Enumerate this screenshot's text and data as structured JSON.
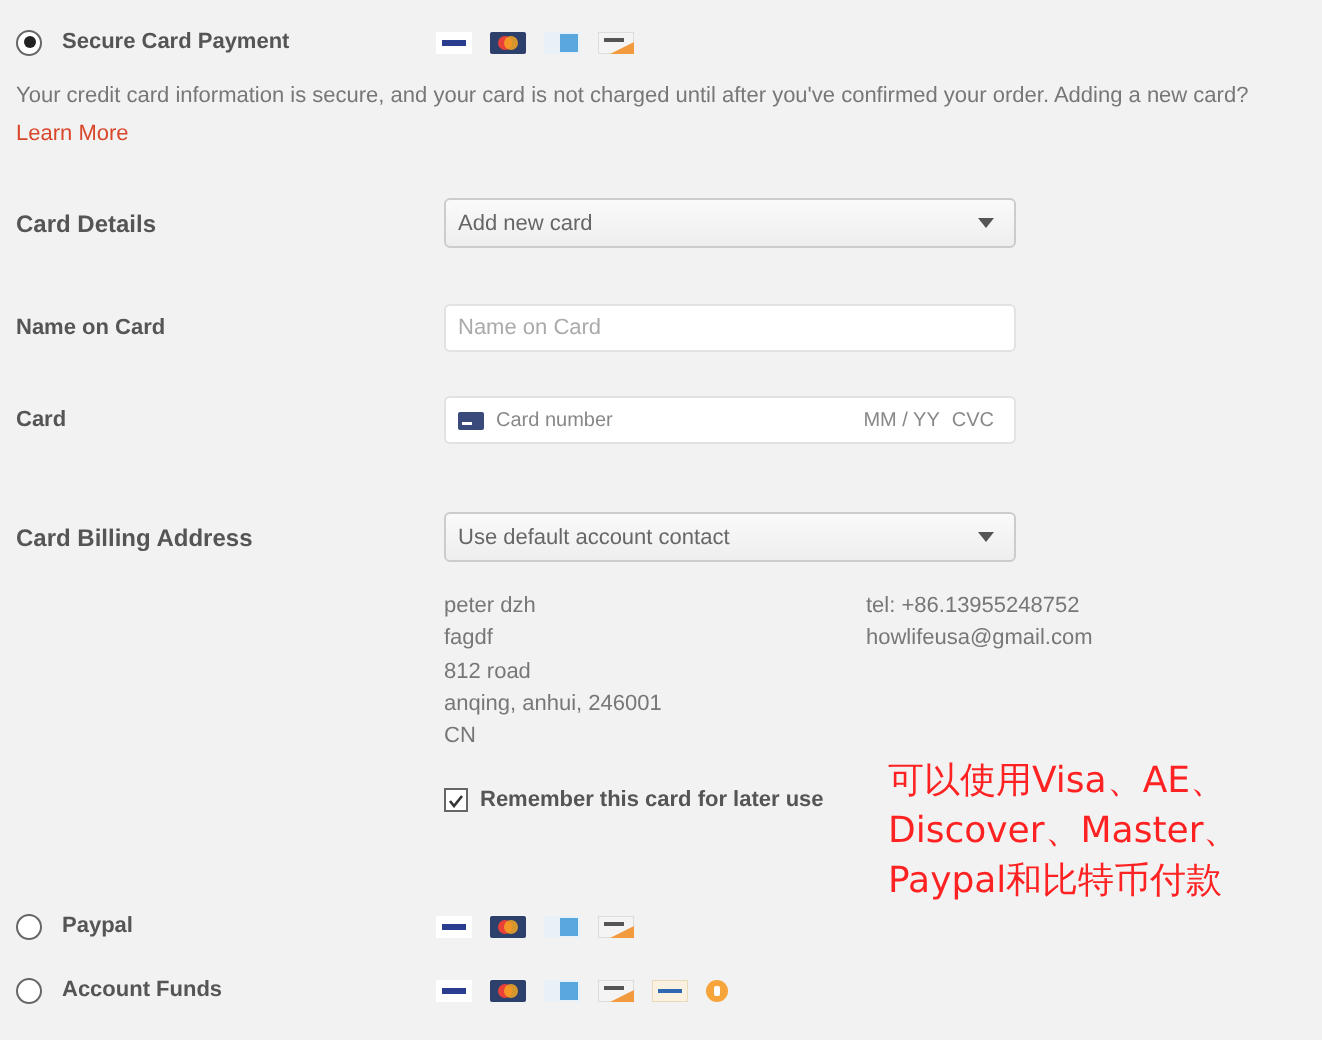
{
  "payment_methods": [
    {
      "label": "Secure Card Payment",
      "selected": true,
      "logos": [
        {
          "kind": "visa"
        },
        {
          "kind": "mastercard"
        },
        {
          "kind": "amex"
        },
        {
          "kind": "discover"
        }
      ],
      "details": {
        "description": "Your credit card information is secure, and your card is not charged until after you've confirmed your order. Adding a new card?",
        "link": "Learn More",
        "fields": [
          {
            "kind": "select",
            "label": "Card Details",
            "value": "Add new card"
          },
          {
            "kind": "text",
            "label": "Name on Card",
            "placeholder": "Name on Card"
          },
          {
            "kind": "card",
            "label": "Card",
            "placeholder": "Card number",
            "expiry_placeholder": "MM / YY",
            "cvc_placeholder": "CVC"
          },
          {
            "kind": "select",
            "label": "Card Billing Address",
            "value": "Use default account contact"
          }
        ],
        "address": [
          "peter dzh",
          "fagdf",
          "812 road",
          "anqing, anhui, 246001",
          "CN"
        ],
        "contact": [
          "tel: +86.13955248752",
          "howlifeusa@gmail.com"
        ],
        "remember": {
          "label": "Remember this card for later use",
          "checked": true
        }
      }
    },
    {
      "label": "Paypal",
      "selected": false,
      "logos": [
        {
          "kind": "visa"
        },
        {
          "kind": "mastercard"
        },
        {
          "kind": "amex"
        },
        {
          "kind": "discover"
        }
      ]
    },
    {
      "label": "Account Funds",
      "selected": false,
      "logos": [
        {
          "kind": "visa"
        },
        {
          "kind": "mastercard"
        },
        {
          "kind": "amex"
        },
        {
          "kind": "discover"
        },
        {
          "kind": "paypal"
        },
        {
          "kind": "bitcoin"
        }
      ]
    }
  ],
  "annotation": [
    "可以使用Visa、AE、",
    "Discover、Master、",
    "Paypal和比特币付款"
  ]
}
